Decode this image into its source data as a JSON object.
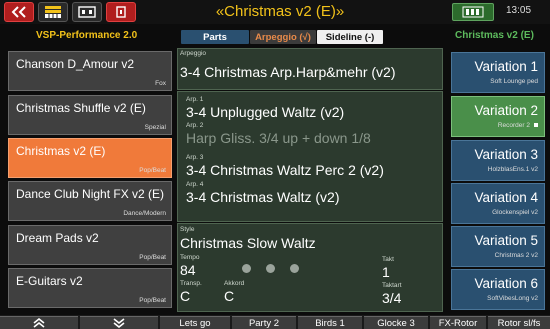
{
  "topbar": {
    "title": "«Christmas v2 (E)»",
    "clock": "13:05",
    "icons": [
      "back-icon",
      "keyboard-icon",
      "drawbar-icon",
      "record-icon",
      "registration-icon"
    ]
  },
  "header": {
    "left_label": "VSP-Performance 2.0",
    "tabs": {
      "parts": "Parts",
      "arpeggio": "Arpeggio (√)",
      "sideline": "Sideline (-)"
    },
    "right_label": "Christmas v2 (E)"
  },
  "songs": [
    {
      "name": "Chanson D_Amour v2",
      "category": "Fox"
    },
    {
      "name": "Christmas Shuffle v2 (E)",
      "category": "Spezial"
    },
    {
      "name": "Christmas v2 (E)",
      "category": "Pop/Beat"
    },
    {
      "name": "Dance Club Night FX v2 (E)",
      "category": "Dance/Modern"
    },
    {
      "name": "Dream Pads v2",
      "category": "Pop/Beat"
    },
    {
      "name": "E-Guitars v2",
      "category": "Pop/Beat"
    }
  ],
  "arpeggio_panel": {
    "label": "Arpeggio",
    "value": "3-4 Christmas Arp.Harp&mehr (v2)"
  },
  "arp_list": [
    {
      "label": "Arp. 1",
      "value": "3-4 Unplugged Waltz (v2)"
    },
    {
      "label": "Arp. 2",
      "value": "Harp Gliss. 3/4 up + down 1/8"
    },
    {
      "label": "Arp. 3",
      "value": "3-4 Christmas Waltz Perc 2 (v2)"
    },
    {
      "label": "Arp. 4",
      "value": "3-4 Christmas Waltz (v2)"
    }
  ],
  "style_panel": {
    "style_label": "Style",
    "style_value": "Christmas Slow Waltz",
    "tempo_label": "Tempo",
    "tempo_value": "84",
    "takt_label": "Takt",
    "takt_value": "1",
    "transp_label": "Transp.",
    "transp_value": "C",
    "akkord_label": "Akkord",
    "akkord_value": "C",
    "taktart_label": "Taktart",
    "taktart_value": "3/4"
  },
  "variations": [
    {
      "name": "Variation 1",
      "sub": "Soft Lounge ped"
    },
    {
      "name": "Variation 2",
      "sub": "Recorder 2"
    },
    {
      "name": "Variation 3",
      "sub": "HolzblasEns.1 v2"
    },
    {
      "name": "Variation 4",
      "sub": "Glockenspiel v2"
    },
    {
      "name": "Variation 5",
      "sub": "Christmas 2 v2"
    },
    {
      "name": "Variation 6",
      "sub": "SoftVibesLong v2"
    }
  ],
  "bottom_bar": {
    "up": "«",
    "down": "»",
    "buttons": [
      "Lets go",
      "Party 2",
      "Birds 1",
      "Glocke 3",
      "FX-Rotor",
      "Rotor sl/fs"
    ]
  },
  "colors": {
    "title_yellow": "#f2c21a",
    "song_active": "#f07a3a",
    "variation_blue": "#2a5070",
    "variation_active": "#4a8f4a",
    "panel_green": "#2c3a2e"
  }
}
